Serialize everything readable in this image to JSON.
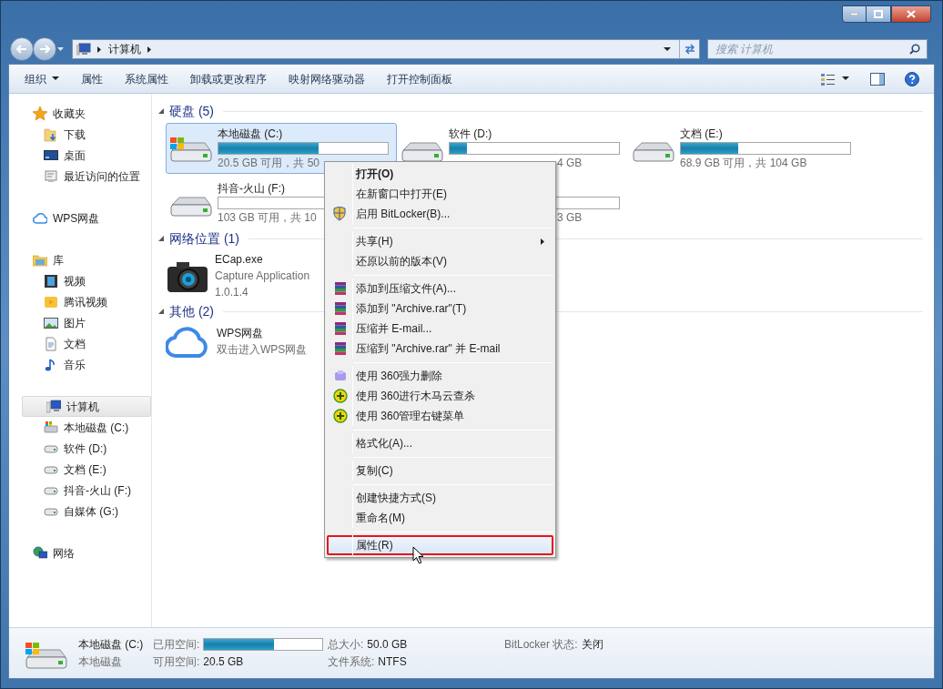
{
  "address_bar": {
    "path": [
      "计算机"
    ],
    "search_placeholder": "搜索 计算机"
  },
  "toolbar": {
    "items": [
      {
        "label": "组织",
        "dropdown": true
      },
      {
        "label": "属性",
        "dropdown": false
      },
      {
        "label": "系统属性",
        "dropdown": false
      },
      {
        "label": "卸载或更改程序",
        "dropdown": false
      },
      {
        "label": "映射网络驱动器",
        "dropdown": false
      },
      {
        "label": "打开控制面板",
        "dropdown": false
      }
    ]
  },
  "sidebar": {
    "items": [
      {
        "label": "收藏夹",
        "selected": false,
        "children": [
          {
            "label": "下载",
            "selected": false
          },
          {
            "label": "桌面",
            "selected": false
          },
          {
            "label": "最近访问的位置",
            "selected": false
          }
        ]
      },
      {
        "label": "WPS网盘",
        "selected": false
      },
      {
        "label": "库",
        "selected": false,
        "children": [
          {
            "label": "视频",
            "selected": false
          },
          {
            "label": "腾讯视频",
            "selected": false
          },
          {
            "label": "图片",
            "selected": false
          },
          {
            "label": "文档",
            "selected": false
          },
          {
            "label": "音乐",
            "selected": false
          }
        ]
      },
      {
        "label": "计算机",
        "selected": true,
        "children": [
          {
            "label": "本地磁盘 (C:)",
            "selected": false
          },
          {
            "label": "软件 (D:)",
            "selected": false
          },
          {
            "label": "文档 (E:)",
            "selected": false
          },
          {
            "label": "抖音-火山 (F:)",
            "selected": false
          },
          {
            "label": "自媒体 (G:)",
            "selected": false
          }
        ]
      },
      {
        "label": "网络",
        "selected": false
      }
    ]
  },
  "content": {
    "sections": [
      {
        "title": "硬盘 (5)",
        "kind": "drives",
        "items": [
          {
            "kind": "full",
            "name": "本地磁盘 (C:)",
            "level": 0.59,
            "info": "20.5 GB 可用，共 50",
            "selected": true
          },
          {
            "kind": "covered",
            "name": "软件 (D:)",
            "level": 0.1,
            "info": "4 GB",
            "selected": false
          },
          {
            "kind": "full",
            "name": "文档 (E:)",
            "level": 0.34,
            "info": "68.9 GB 可用，共 104 GB",
            "selected": false
          },
          {
            "kind": "full",
            "name": "抖音-火山 (F:)",
            "level": 0,
            "info": "103 GB 可用，共 10",
            "selected": false
          },
          {
            "kind": "covered",
            "info": "3 GB",
            "selected": false
          }
        ]
      },
      {
        "title": "网络位置 (1)",
        "kind": "apps",
        "items": [
          {
            "name": "ECap.exe",
            "lines": [
              "Capture Application",
              "1.0.1.4"
            ]
          }
        ]
      },
      {
        "title": "其他 (2)",
        "kind": "apps",
        "items": [
          {
            "name": "WPS网盘",
            "lines": [
              "双击进入WPS网盘"
            ]
          }
        ]
      }
    ]
  },
  "context_menu": {
    "items": [
      {
        "kind": "item",
        "label": "打开(O)",
        "bold": true,
        "selected": false
      },
      {
        "kind": "item",
        "label": "在新窗口中打开(E)",
        "bold": false,
        "selected": false
      },
      {
        "kind": "item",
        "label": "启用 BitLocker(B)...",
        "bold": false,
        "selected": false
      },
      {
        "kind": "separator"
      },
      {
        "kind": "item",
        "label": "共享(H)",
        "bold": false,
        "selected": false,
        "submenu": true
      },
      {
        "kind": "item",
        "label": "还原以前的版本(V)",
        "bold": false,
        "selected": false
      },
      {
        "kind": "separator"
      },
      {
        "kind": "item",
        "label": "添加到压缩文件(A)...",
        "bold": false,
        "selected": false
      },
      {
        "kind": "item",
        "label": "添加到 \"Archive.rar\"(T)",
        "bold": false,
        "selected": false
      },
      {
        "kind": "item",
        "label": "压缩并 E-mail...",
        "bold": false,
        "selected": false
      },
      {
        "kind": "item",
        "label": "压缩到 \"Archive.rar\" 并 E-mail",
        "bold": false,
        "selected": false
      },
      {
        "kind": "separator"
      },
      {
        "kind": "item",
        "label": "使用 360强力删除",
        "bold": false,
        "selected": false
      },
      {
        "kind": "item",
        "label": "使用 360进行木马云查杀",
        "bold": false,
        "selected": false
      },
      {
        "kind": "item",
        "label": "使用 360管理右键菜单",
        "bold": false,
        "selected": false
      },
      {
        "kind": "separator"
      },
      {
        "kind": "item",
        "label": "格式化(A)...",
        "bold": false,
        "selected": false
      },
      {
        "kind": "separator"
      },
      {
        "kind": "item",
        "label": "复制(C)",
        "bold": false,
        "selected": false
      },
      {
        "kind": "separator"
      },
      {
        "kind": "item",
        "label": "创建快捷方式(S)",
        "bold": false,
        "selected": false
      },
      {
        "kind": "item",
        "label": "重命名(M)",
        "bold": false,
        "selected": false
      },
      {
        "kind": "separator"
      },
      {
        "kind": "item",
        "label": "属性(R)",
        "bold": false,
        "selected": true
      }
    ]
  },
  "status_bar": {
    "name": "本地磁盘 (C:)",
    "type": "本地磁盘",
    "fields": [
      {
        "kind": "bar",
        "label": "已用空间:",
        "level": 0.59
      },
      {
        "kind": "text",
        "label": "总大小:",
        "value": "50.0 GB"
      },
      {
        "kind": "text",
        "label": "BitLocker 状态:",
        "value": "关闭"
      },
      {
        "kind": "text",
        "label": "可用空间:",
        "value": "20.5 GB"
      },
      {
        "kind": "text",
        "label": "文件系统:",
        "value": "NTFS"
      }
    ]
  }
}
